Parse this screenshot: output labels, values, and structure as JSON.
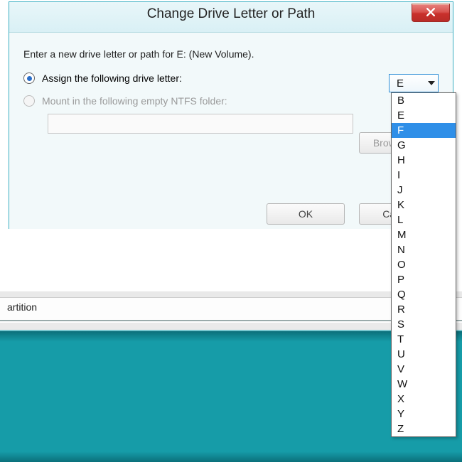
{
  "window": {
    "title": "Change Drive Letter or Path"
  },
  "prompt": "Enter a new drive letter or path for E: (New Volume).",
  "options": {
    "assign_label": "Assign the following drive letter:",
    "mount_label": "Mount in the following empty NTFS folder:"
  },
  "drive_select": {
    "value": "E",
    "highlighted": "F",
    "items": [
      "B",
      "E",
      "F",
      "G",
      "H",
      "I",
      "J",
      "K",
      "L",
      "M",
      "N",
      "O",
      "P",
      "Q",
      "R",
      "S",
      "T",
      "U",
      "V",
      "W",
      "X",
      "Y",
      "Z"
    ]
  },
  "buttons": {
    "browse": "Browse...",
    "ok": "OK",
    "cancel": "Cancel"
  },
  "background": {
    "partition_label": "artition"
  }
}
